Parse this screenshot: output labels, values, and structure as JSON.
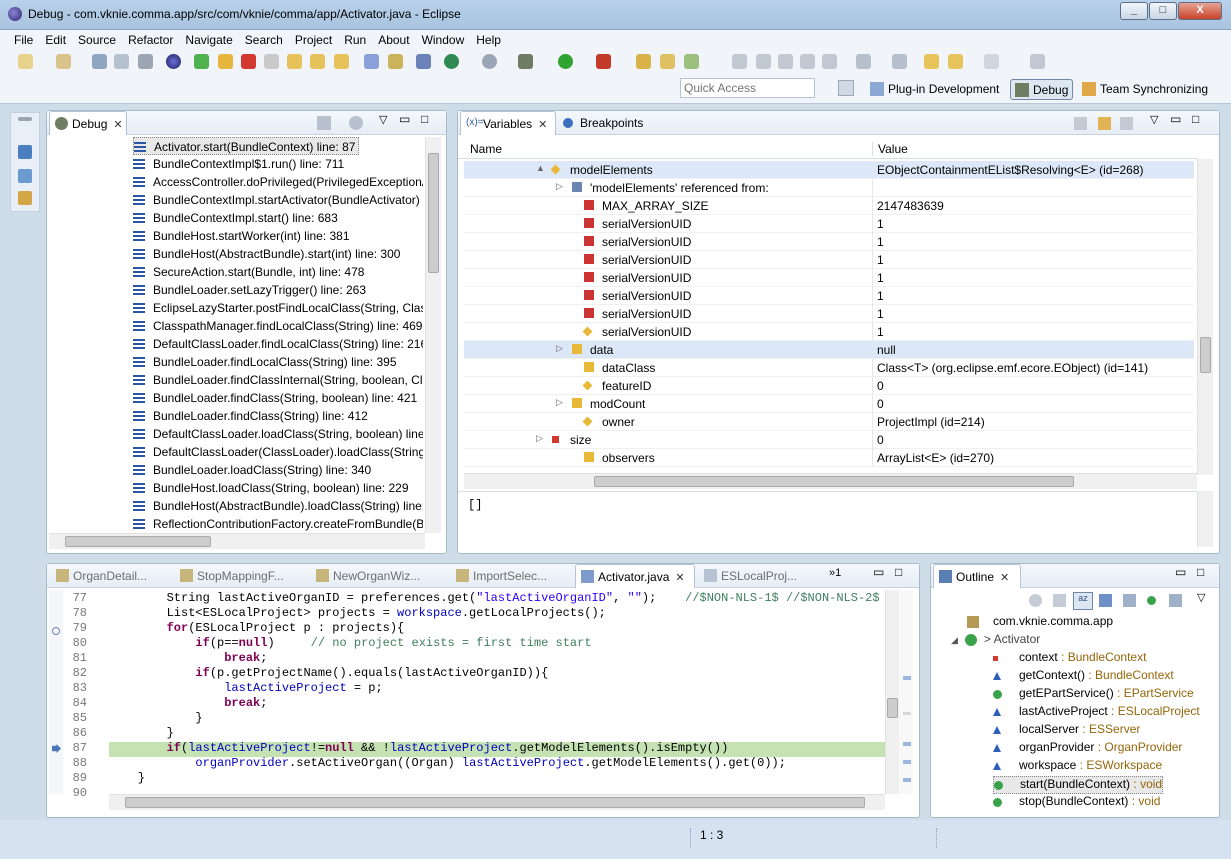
{
  "window": {
    "title": "Debug - com.vknie.comma.app/src/com/vknie/comma/app/Activator.java - Eclipse",
    "minimize": "_",
    "maximize": "□",
    "close": "X"
  },
  "menubar": [
    "File",
    "Edit",
    "Source",
    "Refactor",
    "Navigate",
    "Search",
    "Project",
    "Run",
    "About",
    "Window",
    "Help"
  ],
  "toolbar": {
    "quick_access_placeholder": "Quick Access",
    "perspectives": [
      "Plug-in Development",
      "Debug",
      "Team Synchronizing"
    ]
  },
  "debug_view": {
    "tab": "Debug",
    "frames": [
      "Activator.start(BundleContext) line: 87",
      "BundleContextImpl$1.run() line: 711",
      "AccessController.doPrivileged(PrivilegedExceptionA",
      "BundleContextImpl.startActivator(BundleActivator)",
      "BundleContextImpl.start() line: 683",
      "BundleHost.startWorker(int) line: 381",
      "BundleHost(AbstractBundle).start(int) line: 300",
      "SecureAction.start(Bundle, int) line: 478",
      "BundleLoader.setLazyTrigger() line: 263",
      "EclipseLazyStarter.postFindLocalClass(String, Class<",
      "ClasspathManager.findLocalClass(String) line: 469",
      "DefaultClassLoader.findLocalClass(String) line: 216",
      "BundleLoader.findLocalClass(String) line: 395",
      "BundleLoader.findClassInternal(String, boolean, Cla",
      "BundleLoader.findClass(String, boolean) line: 421",
      "BundleLoader.findClass(String) line: 412",
      "DefaultClassLoader.loadClass(String, boolean) line:",
      "DefaultClassLoader(ClassLoader).loadClass(String) l",
      "BundleLoader.loadClass(String) line: 340",
      "BundleHost.loadClass(String, boolean) line: 229",
      "BundleHost(AbstractBundle).loadClass(String) line:",
      "ReflectionContributionFactory.createFromBundle(B"
    ]
  },
  "variables_view": {
    "tabs": [
      "Variables",
      "Breakpoints"
    ],
    "columns": [
      "Name",
      "Value"
    ],
    "rows": [
      {
        "name": "modelElements",
        "value": "EObjectContainmentEList$Resolving<E>  (id=268)"
      },
      {
        "name": "'modelElements' referenced from:",
        "value": ""
      },
      {
        "name": "MAX_ARRAY_SIZE",
        "value": "2147483639"
      },
      {
        "name": "serialVersionUID",
        "value": "1"
      },
      {
        "name": "serialVersionUID",
        "value": "1"
      },
      {
        "name": "serialVersionUID",
        "value": "1"
      },
      {
        "name": "serialVersionUID",
        "value": "1"
      },
      {
        "name": "serialVersionUID",
        "value": "1"
      },
      {
        "name": "serialVersionUID",
        "value": "1"
      },
      {
        "name": "serialVersionUID",
        "value": "1"
      },
      {
        "name": "data",
        "value": "null"
      },
      {
        "name": "dataClass",
        "value": "Class<T> (org.eclipse.emf.ecore.EObject) (id=141)"
      },
      {
        "name": "featureID",
        "value": "0"
      },
      {
        "name": "modCount",
        "value": "0"
      },
      {
        "name": "owner",
        "value": "ProjectImpl  (id=214)"
      },
      {
        "name": "size",
        "value": "0"
      },
      {
        "name": "observers",
        "value": "ArrayList<E>  (id=270)"
      }
    ],
    "detail": "[]"
  },
  "editor": {
    "tabs": [
      "OrganDetail...",
      "StopMappingF...",
      "NewOrganWiz...",
      "ImportSelec...",
      "Activator.java",
      "ESLocalProj..."
    ],
    "overflow": "»1",
    "lines": [
      {
        "n": "77"
      },
      {
        "n": "78"
      },
      {
        "n": "79"
      },
      {
        "n": "80"
      },
      {
        "n": "81"
      },
      {
        "n": "82"
      },
      {
        "n": "83"
      },
      {
        "n": "84"
      },
      {
        "n": "85"
      },
      {
        "n": "86"
      },
      {
        "n": "87"
      },
      {
        "n": "88"
      },
      {
        "n": "89"
      },
      {
        "n": "90"
      }
    ]
  },
  "outline_view": {
    "tab": "Outline",
    "package": "com.vknie.comma.app",
    "class": "> Activator",
    "members": [
      {
        "name": "context",
        "type": " : BundleContext"
      },
      {
        "name": "getContext()",
        "type": " : BundleContext"
      },
      {
        "name": "getEPartService()",
        "type": " : EPartService"
      },
      {
        "name": "lastActiveProject",
        "type": " : ESLocalProject"
      },
      {
        "name": "localServer",
        "type": " : ESServer"
      },
      {
        "name": "organProvider",
        "type": " : OrganProvider"
      },
      {
        "name": "workspace",
        "type": " : ESWorkspace"
      },
      {
        "name": "start(BundleContext)",
        "type": " : void"
      },
      {
        "name": "stop(BundleContext)",
        "type": " : void"
      }
    ]
  },
  "status": {
    "position": "1 : 3"
  }
}
